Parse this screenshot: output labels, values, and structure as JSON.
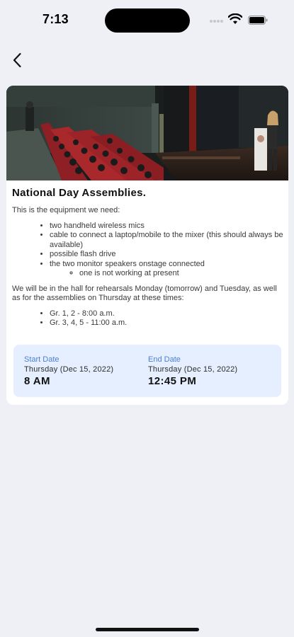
{
  "status_bar": {
    "time": "7:13"
  },
  "navigation": {
    "back_icon": "chevron-left-icon"
  },
  "event": {
    "image_alt": "Auditorium with audience seated in red seats and a speaker at a podium on stage",
    "title": "National Day Assemblies.",
    "intro": "This is the equipment we need:",
    "equipment": [
      "two handheld wireless mics",
      "cable to connect a laptop/mobile to the mixer (this should always be available)",
      "possible flash drive",
      "the two monitor speakers onstage connected"
    ],
    "equipment_sub": [
      "one is not working at present"
    ],
    "schedule_text": "We will be in the hall for rehearsals Monday (tomorrow) and Tuesday, as well as for the assemblies on Thursday at these times:",
    "grades": [
      "Gr. 1, 2 - 8:00 a.m.",
      "Gr. 3, 4, 5 - 11:00 a.m."
    ],
    "start": {
      "label": "Start Date",
      "day": "Thursday (Dec 15, 2022)",
      "time": "8 AM"
    },
    "end": {
      "label": "End Date",
      "day": "Thursday (Dec 15, 2022)",
      "time": "12:45 PM"
    }
  },
  "colors": {
    "background": "#eef0f5",
    "card": "#ffffff",
    "date_box": "#e6efff",
    "date_label": "#4a7fd6",
    "seat_red": "#a8282c"
  }
}
